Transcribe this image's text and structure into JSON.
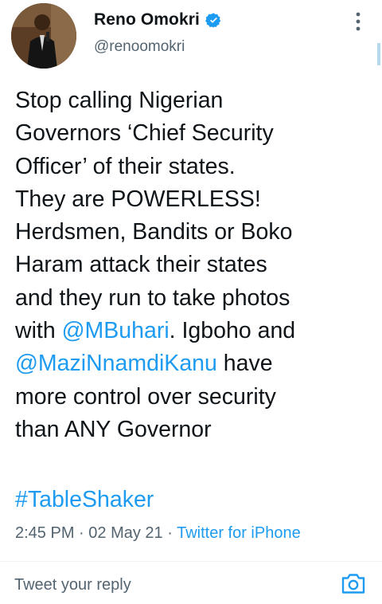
{
  "author": {
    "display_name": "Reno Omokri",
    "handle": "@renoomokri",
    "verified": true
  },
  "tweet": {
    "lines": [
      [
        {
          "text": "Stop calling Nigerian"
        }
      ],
      [
        {
          "text": "Governors ‘Chief Security"
        }
      ],
      [
        {
          "text": "Officer’ of their states."
        }
      ],
      [
        {
          "text": "They are POWERLESS!"
        }
      ],
      [
        {
          "text": "Herdsmen, Bandits or Boko"
        }
      ],
      [
        {
          "text": "Haram attack their states"
        }
      ],
      [
        {
          "text": "and they run to take photos"
        }
      ],
      [
        {
          "text": "with "
        },
        {
          "text": "@MBuhari",
          "link": true
        },
        {
          "text": ". Igboho and"
        }
      ],
      [
        {
          "text": "@MaziNnamdiKanu",
          "link": true
        },
        {
          "text": " have"
        }
      ],
      [
        {
          "text": "more control over security"
        }
      ],
      [
        {
          "text": "than ANY Governor"
        }
      ]
    ],
    "hashtag": "#TableShaker",
    "time": "2:45 PM",
    "separator": " · ",
    "date": "02 May 21",
    "source": "Twitter for iPhone"
  },
  "reply": {
    "placeholder": "Tweet your reply"
  },
  "icons": {
    "verified": "verified-badge-icon",
    "more": "more-vertical-icon",
    "camera": "camera-icon"
  },
  "colors": {
    "accent": "#1d9bf0",
    "text": "#0f1419",
    "secondary": "#536471"
  }
}
